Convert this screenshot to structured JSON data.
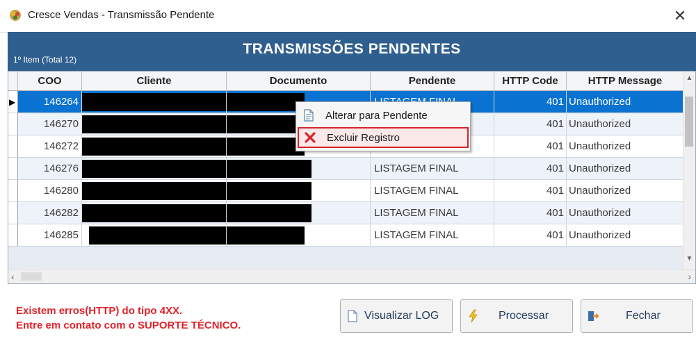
{
  "window": {
    "title": "Cresce Vendas - Transmissão Pendente",
    "close_glyph": "✕",
    "app_icon": "app-logo-icon"
  },
  "header": {
    "info": "1º Item (Total 12)",
    "title": "TRANSMISSÕES PENDENTES",
    "band_color": "#2f5f8e"
  },
  "grid": {
    "columns": [
      "COO",
      "Cliente",
      "Documento",
      "Pendente",
      "HTTP Code",
      "HTTP Message"
    ],
    "rows": [
      {
        "coo": "146264",
        "pendente": "LISTAGEM FINAL",
        "http_code": "401",
        "http_message": "Unauthorized"
      },
      {
        "coo": "146270",
        "pendente": "",
        "http_code": "401",
        "http_message": "Unauthorized"
      },
      {
        "coo": "146272",
        "pendente": "LISTAGEM FINAL",
        "http_code": "401",
        "http_message": "Unauthorized"
      },
      {
        "coo": "146276",
        "pendente": "LISTAGEM FINAL",
        "http_code": "401",
        "http_message": "Unauthorized"
      },
      {
        "coo": "146280",
        "pendente": "LISTAGEM FINAL",
        "http_code": "401",
        "http_message": "Unauthorized"
      },
      {
        "coo": "146282",
        "pendente": "LISTAGEM FINAL",
        "http_code": "401",
        "http_message": "Unauthorized"
      },
      {
        "coo": "146285",
        "pendente": "LISTAGEM FINAL",
        "http_code": "401",
        "http_message": "Unauthorized"
      }
    ],
    "selected_row_color": "#0a73d2",
    "row_marker": "▶"
  },
  "context_menu": {
    "items": [
      {
        "label": "Alterar para Pendente",
        "icon": "document-icon"
      },
      {
        "label": "Excluir Registro",
        "icon": "delete-x-icon"
      }
    ],
    "highlight_color": "#d9232a"
  },
  "footer": {
    "error_line1": "Existem erros(HTTP) do tipo 4XX.",
    "error_line2": "Entre em contato com o SUPORTE TÉCNICO.",
    "error_color": "#e2222a"
  },
  "buttons": {
    "view_log": {
      "label": "Visualizar LOG",
      "icon": "document-icon"
    },
    "process": {
      "label": "Processar",
      "icon": "lightning-icon"
    },
    "close": {
      "label": "Fechar",
      "icon": "exit-door-icon"
    }
  }
}
